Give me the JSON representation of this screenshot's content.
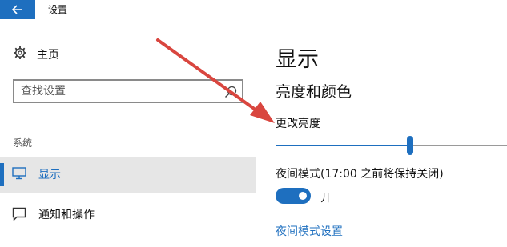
{
  "window": {
    "title": "设置",
    "back_icon": "back-arrow-icon"
  },
  "sidebar": {
    "home": {
      "label": "主页",
      "icon": "gear-icon"
    },
    "search": {
      "placeholder": "查找设置",
      "icon": "search-icon"
    },
    "section_label": "系统",
    "items": [
      {
        "label": "显示",
        "icon": "monitor-icon",
        "selected": true
      },
      {
        "label": "通知和操作",
        "icon": "notification-icon",
        "selected": false
      }
    ]
  },
  "main": {
    "page_title": "显示",
    "section_title": "亮度和颜色",
    "brightness": {
      "label": "更改亮度",
      "value_percent": 58
    },
    "night_mode": {
      "label": "夜间模式(17:00 之前将保持关闭)",
      "toggle_state": "开",
      "toggle_on": true,
      "settings_link": "夜间模式设置"
    }
  },
  "colors": {
    "accent": "#1e6fbf",
    "annotation_arrow": "#d9463f",
    "selected_row": "#e6e6e6"
  }
}
